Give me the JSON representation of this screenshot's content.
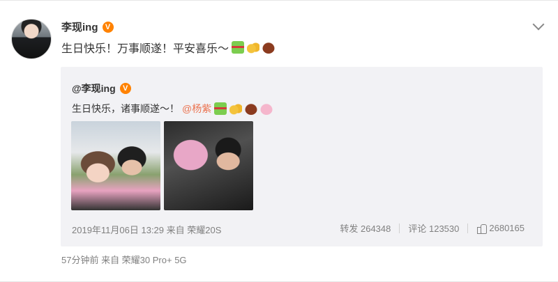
{
  "post": {
    "author": "李现ing",
    "verified_badge": "V",
    "text": "生日快乐！万事顺遂！平安喜乐～",
    "emojis": [
      "gift-icon",
      "cheers-icon",
      "cake-icon"
    ],
    "footer": "57分钟前  来自 荣耀30 Pro+ 5G"
  },
  "repost": {
    "author": "@李现ing",
    "verified_badge": "V",
    "text": "生日快乐，诸事顺遂～！",
    "mention": "@杨紫",
    "emojis": [
      "gift-icon",
      "cheers-icon",
      "cake-icon",
      "bunny-icon"
    ],
    "meta": "2019年11月06日 13:29 来自 荣耀20S",
    "reposts_label": "转发 264348",
    "comments_label": "评论 123530",
    "likes": "2680165"
  },
  "colors": {
    "verified": "#ff8200",
    "mention": "#eb7350",
    "repost_bg": "#f2f2f5"
  }
}
